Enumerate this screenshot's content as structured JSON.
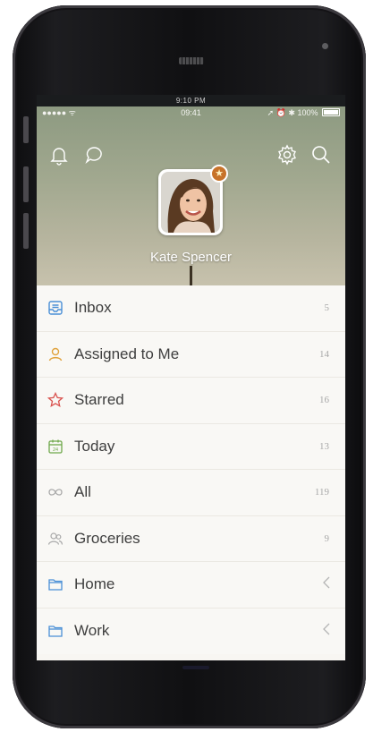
{
  "top_strip": {
    "text": "9:10 PM"
  },
  "status_bar": {
    "carrier": "●●●●● ᯤ",
    "time": "09:41",
    "icons": "➚ ⏰ ✱",
    "battery_percent": "100%"
  },
  "header": {
    "user_name": "Kate Spencer",
    "icons": [
      "bell-icon",
      "chat-bubble-icon",
      "gear-icon",
      "search-icon"
    ],
    "badge_icon": "star-icon"
  },
  "lists": [
    {
      "label": "Inbox",
      "count": "5",
      "icon": "inbox-icon",
      "color": "#4a8fd6"
    },
    {
      "label": "Assigned to Me",
      "count": "14",
      "icon": "person-icon",
      "color": "#e0a23c"
    },
    {
      "label": "Starred",
      "count": "16",
      "icon": "star-outline-icon",
      "color": "#d9534f"
    },
    {
      "label": "Today",
      "count": "13",
      "icon": "calendar-icon",
      "color": "#6ea84a"
    },
    {
      "label": "All",
      "count": "119",
      "icon": "infinity-icon",
      "color": "#a9a9a9"
    },
    {
      "label": "Groceries",
      "count": "9",
      "icon": "people-icon",
      "color": "#a9a9a9"
    },
    {
      "label": "Home",
      "icon": "folder-icon",
      "color": "#4a8fd6"
    },
    {
      "label": "Work",
      "icon": "folder-icon",
      "color": "#4a8fd6"
    }
  ]
}
